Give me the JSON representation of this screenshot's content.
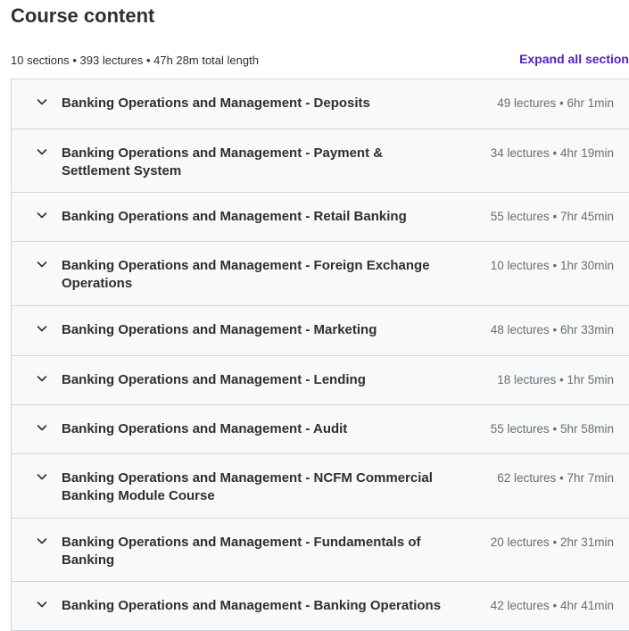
{
  "header": {
    "title": "Course content",
    "summary": "10 sections • 393 lectures • 47h 28m total length",
    "expand_all_label": "Expand all section"
  },
  "sections": [
    {
      "title": "Banking Operations and Management - Deposits",
      "meta": "49 lectures • 6hr 1min"
    },
    {
      "title": "Banking Operations and Management - Payment & Settlement System",
      "meta": "34 lectures • 4hr 19min"
    },
    {
      "title": "Banking Operations and Management - Retail Banking",
      "meta": "55 lectures • 7hr 45min"
    },
    {
      "title": "Banking Operations and Management - Foreign Exchange Operations",
      "meta": "10 lectures • 1hr 30min"
    },
    {
      "title": "Banking Operations and Management - Marketing",
      "meta": "48 lectures • 6hr 33min"
    },
    {
      "title": "Banking Operations and Management - Lending",
      "meta": "18 lectures • 1hr 5min"
    },
    {
      "title": "Banking Operations and Management - Audit",
      "meta": "55 lectures • 5hr 58min"
    },
    {
      "title": "Banking Operations and Management - NCFM Commercial Banking Module Course",
      "meta": "62 lectures • 7hr 7min"
    },
    {
      "title": "Banking Operations and Management - Fundamentals of Banking",
      "meta": "20 lectures • 2hr 31min"
    },
    {
      "title": "Banking Operations and Management - Banking Operations",
      "meta": "42 lectures • 4hr 41min"
    }
  ],
  "colors": {
    "accent": "#5022c3",
    "section_bg": "#f7f9fa",
    "border": "#d1d7dc",
    "text": "#2d2f31",
    "muted": "#6a6f73"
  },
  "icons": {
    "section_toggle": "chevron-down-icon"
  }
}
